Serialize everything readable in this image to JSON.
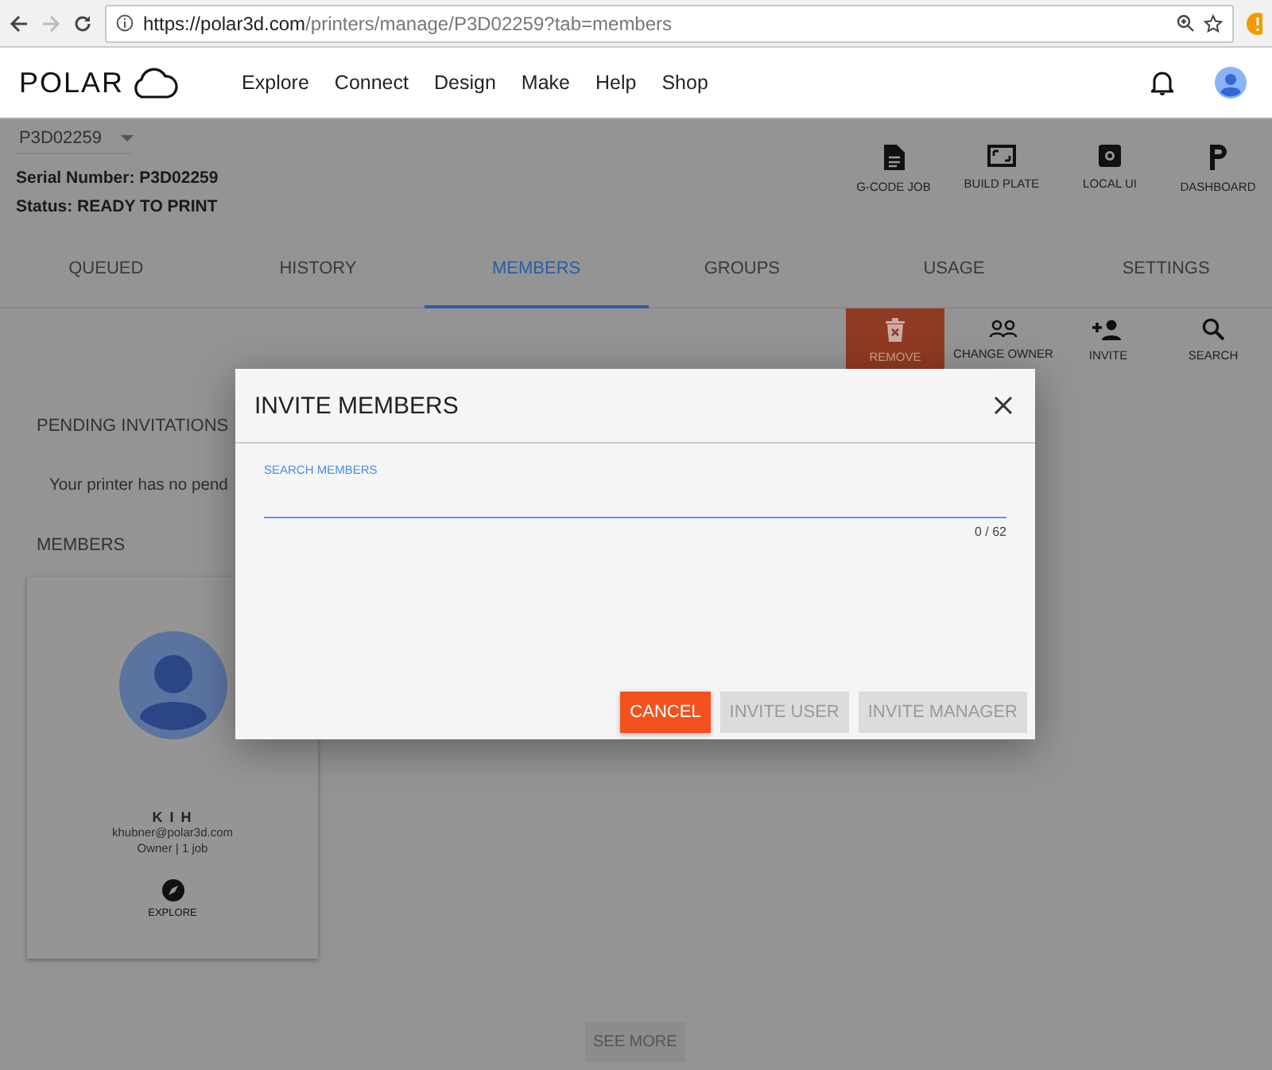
{
  "browser": {
    "url_host": "https://polar3d.com",
    "url_path": "/printers/manage/P3D02259?tab=members"
  },
  "header": {
    "logo": "POLAR",
    "nav": [
      "Explore",
      "Connect",
      "Design",
      "Make",
      "Help",
      "Shop"
    ]
  },
  "printer": {
    "selector": "P3D02259",
    "serial": "Serial Number: P3D02259",
    "status": "Status: READY TO PRINT"
  },
  "printer_actions": [
    {
      "kind": "gcode",
      "label": "G-CODE JOB"
    },
    {
      "kind": "plate",
      "label": "BUILD PLATE"
    },
    {
      "kind": "local",
      "label": "LOCAL UI"
    },
    {
      "kind": "dashboard",
      "label": "DASHBOARD"
    }
  ],
  "tabs": [
    {
      "label": "QUEUED",
      "selected": false
    },
    {
      "label": "HISTORY",
      "selected": false
    },
    {
      "label": "MEMBERS",
      "selected": true
    },
    {
      "label": "GROUPS",
      "selected": false
    },
    {
      "label": "USAGE",
      "selected": false
    },
    {
      "label": "SETTINGS",
      "selected": false
    }
  ],
  "toolbar": [
    {
      "kind": "remove",
      "label": "REMOVE",
      "highlighted": true
    },
    {
      "kind": "owner",
      "label": "CHANGE OWNER",
      "highlighted": false
    },
    {
      "kind": "invite",
      "label": "INVITE",
      "highlighted": false
    },
    {
      "kind": "search",
      "label": "SEARCH",
      "highlighted": false
    }
  ],
  "pending": {
    "heading": "PENDING INVITATIONS",
    "message": "Your printer has no pend"
  },
  "members": {
    "heading": "MEMBERS",
    "cards": [
      {
        "name": "K I H",
        "email": "khubner@polar3d.com",
        "role": "Owner | 1 job",
        "action": "EXPLORE"
      }
    ],
    "see_more": "SEE MORE"
  },
  "dialog": {
    "title": "INVITE MEMBERS",
    "field": {
      "label": "SEARCH MEMBERS",
      "counter": "0 / 62"
    },
    "buttons": [
      {
        "label": "CANCEL",
        "disabled": false
      },
      {
        "label": "INVITE USER",
        "disabled": true
      },
      {
        "label": "INVITE MANAGER",
        "disabled": true
      }
    ]
  }
}
